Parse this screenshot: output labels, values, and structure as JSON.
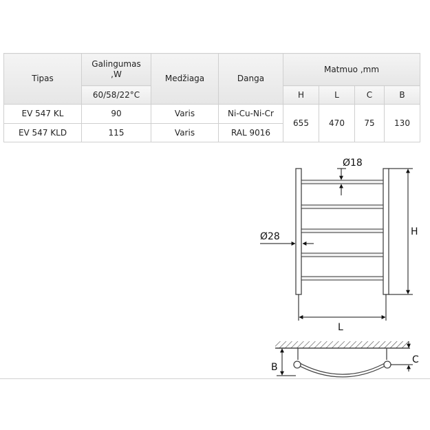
{
  "table": {
    "headers": {
      "tipas": "Tipas",
      "galingumas_line1": "Galingumas",
      "galingumas_line2": ",W",
      "galingumas_sub": "60/58/22°C",
      "medziaga": "Medžiaga",
      "danga": "Danga",
      "matmuo": "Matmuo ,mm",
      "h": "H",
      "l": "L",
      "c": "C",
      "b": "B"
    },
    "rows": [
      {
        "tipas": "EV 547 KL",
        "galingumas": "90",
        "medziaga": "Varis",
        "danga": "Ni-Cu-Ni-Cr"
      },
      {
        "tipas": "EV 547 KLD",
        "galingumas": "115",
        "medziaga": "Varis",
        "danga": "RAL 9016"
      }
    ],
    "dimensions": {
      "h": "655",
      "l": "470",
      "c": "75",
      "b": "130"
    }
  },
  "drawing": {
    "bar_diameter": "Ø18",
    "post_diameter": "Ø28",
    "height_label": "H",
    "length_label": "L",
    "depth_label": "B",
    "offset_label": "C"
  }
}
